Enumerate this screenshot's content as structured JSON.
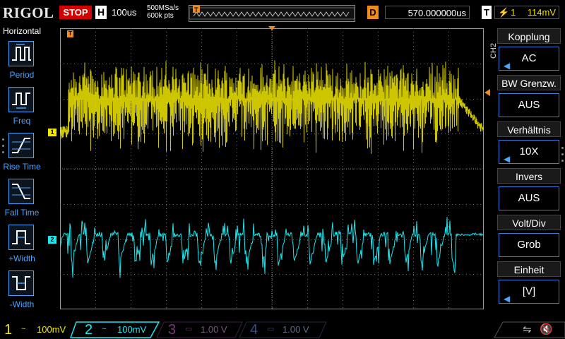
{
  "header": {
    "brand": "RIGOL",
    "run_state": "STOP",
    "timebase_label": "H",
    "timebase_value": "100us",
    "sample_rate": "500MSa/s",
    "memory_depth": "600k pts",
    "trigger_marker": "T",
    "delay_label": "D",
    "delay_value": "570.000000us",
    "trigger_label": "T",
    "trigger_edge_icon": "rising-edge-icon",
    "trigger_level": "114mV"
  },
  "left_menu": {
    "title": "Horizontal",
    "items": [
      {
        "label": "Period",
        "icon": "period-icon"
      },
      {
        "label": "Freq",
        "icon": "frequency-icon"
      },
      {
        "label": "Rise Time",
        "icon": "rise-time-icon"
      },
      {
        "label": "Fall Time",
        "icon": "fall-time-icon"
      },
      {
        "label": "+Width",
        "icon": "positive-width-icon"
      },
      {
        "label": "-Width",
        "icon": "negative-width-icon"
      }
    ]
  },
  "scope": {
    "ch1_marker": "1",
    "ch2_marker": "2",
    "trigger_pos_marker": "T",
    "colors": {
      "ch1": "#f0e800",
      "ch2": "#18e8f0",
      "grid": "#6a6a6a",
      "trigger": "#f08c1e"
    }
  },
  "right_menu": {
    "channel_tag": "CH2",
    "items": [
      {
        "title": "Kopplung",
        "value": "AC",
        "has_arrow": true
      },
      {
        "title": "BW Grenzw.",
        "value": "AUS",
        "has_arrow": false
      },
      {
        "title": "Verhältnis",
        "value": "10X",
        "has_arrow": true
      },
      {
        "title": "Invers",
        "value": "AUS",
        "has_arrow": false
      },
      {
        "title": "Volt/Div",
        "value": "Grob",
        "has_arrow": false
      },
      {
        "title": "Einheit",
        "value": "[V]",
        "has_arrow": true
      }
    ]
  },
  "bottom": {
    "channels": [
      {
        "num": "1",
        "coupling": "~",
        "scale": "100mV",
        "color": "#f0e800",
        "active": true
      },
      {
        "num": "2",
        "coupling": "~",
        "scale": "100mV",
        "color": "#18e8f0",
        "active": true
      },
      {
        "num": "3",
        "coupling": "",
        "scale": "1.00 V",
        "color": "#7a3a7a",
        "active": false
      },
      {
        "num": "4",
        "coupling": "",
        "scale": "1.00 V",
        "color": "#3a4a8a",
        "active": false
      }
    ]
  }
}
